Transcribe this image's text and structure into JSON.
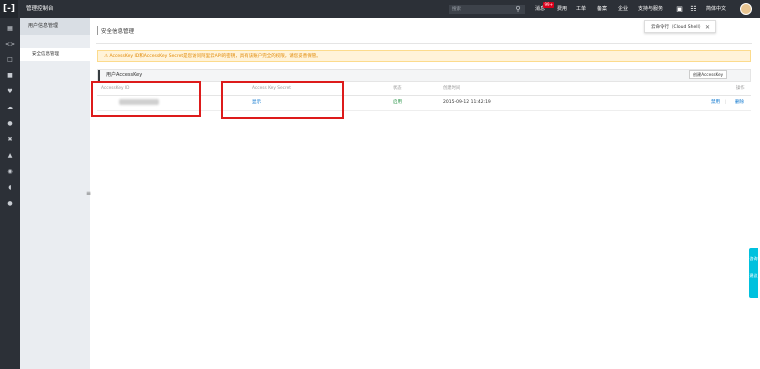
{
  "topbar": {
    "console_title": "管理控制台",
    "search_placeholder": "搜索",
    "messages": "消息",
    "messages_badge": "99+",
    "billing": "费用",
    "tickets": "工单",
    "icp": "备案",
    "enterprise": "企业",
    "support": "支持与服务",
    "language": "简体中文"
  },
  "tooltip": {
    "text": "云命令行（Cloud Shell）"
  },
  "sidebar": {
    "title": "用户信息管理",
    "items": [
      {
        "label": "安全信息管理"
      }
    ]
  },
  "main": {
    "page_title": "安全信息管理",
    "alert": "AccessKey ID和AccessKey Secret是您访问阿里云API的密钥，具有该账户完全的权限，请您妥善保管。",
    "section_title": "用户AccessKey",
    "create_button": "创建AccessKey",
    "columns": [
      "AccessKey ID",
      "Access Key Secret",
      "状态",
      "创建时间",
      "操作"
    ],
    "rows": [
      {
        "secret_action": "显示",
        "status": "启用",
        "created": "2015-09-12 11:42:19",
        "actions": [
          "禁用",
          "|",
          "删除"
        ]
      }
    ]
  },
  "float_tab": {
    "label_1": "咨询",
    "label_2": "建议"
  },
  "colors": {
    "topbar_bg": "#2c3037",
    "link": "#0070cc",
    "status_ok": "#1e8e3e",
    "highlight_box": "#dd1b1b",
    "alert_text": "#e08700"
  }
}
